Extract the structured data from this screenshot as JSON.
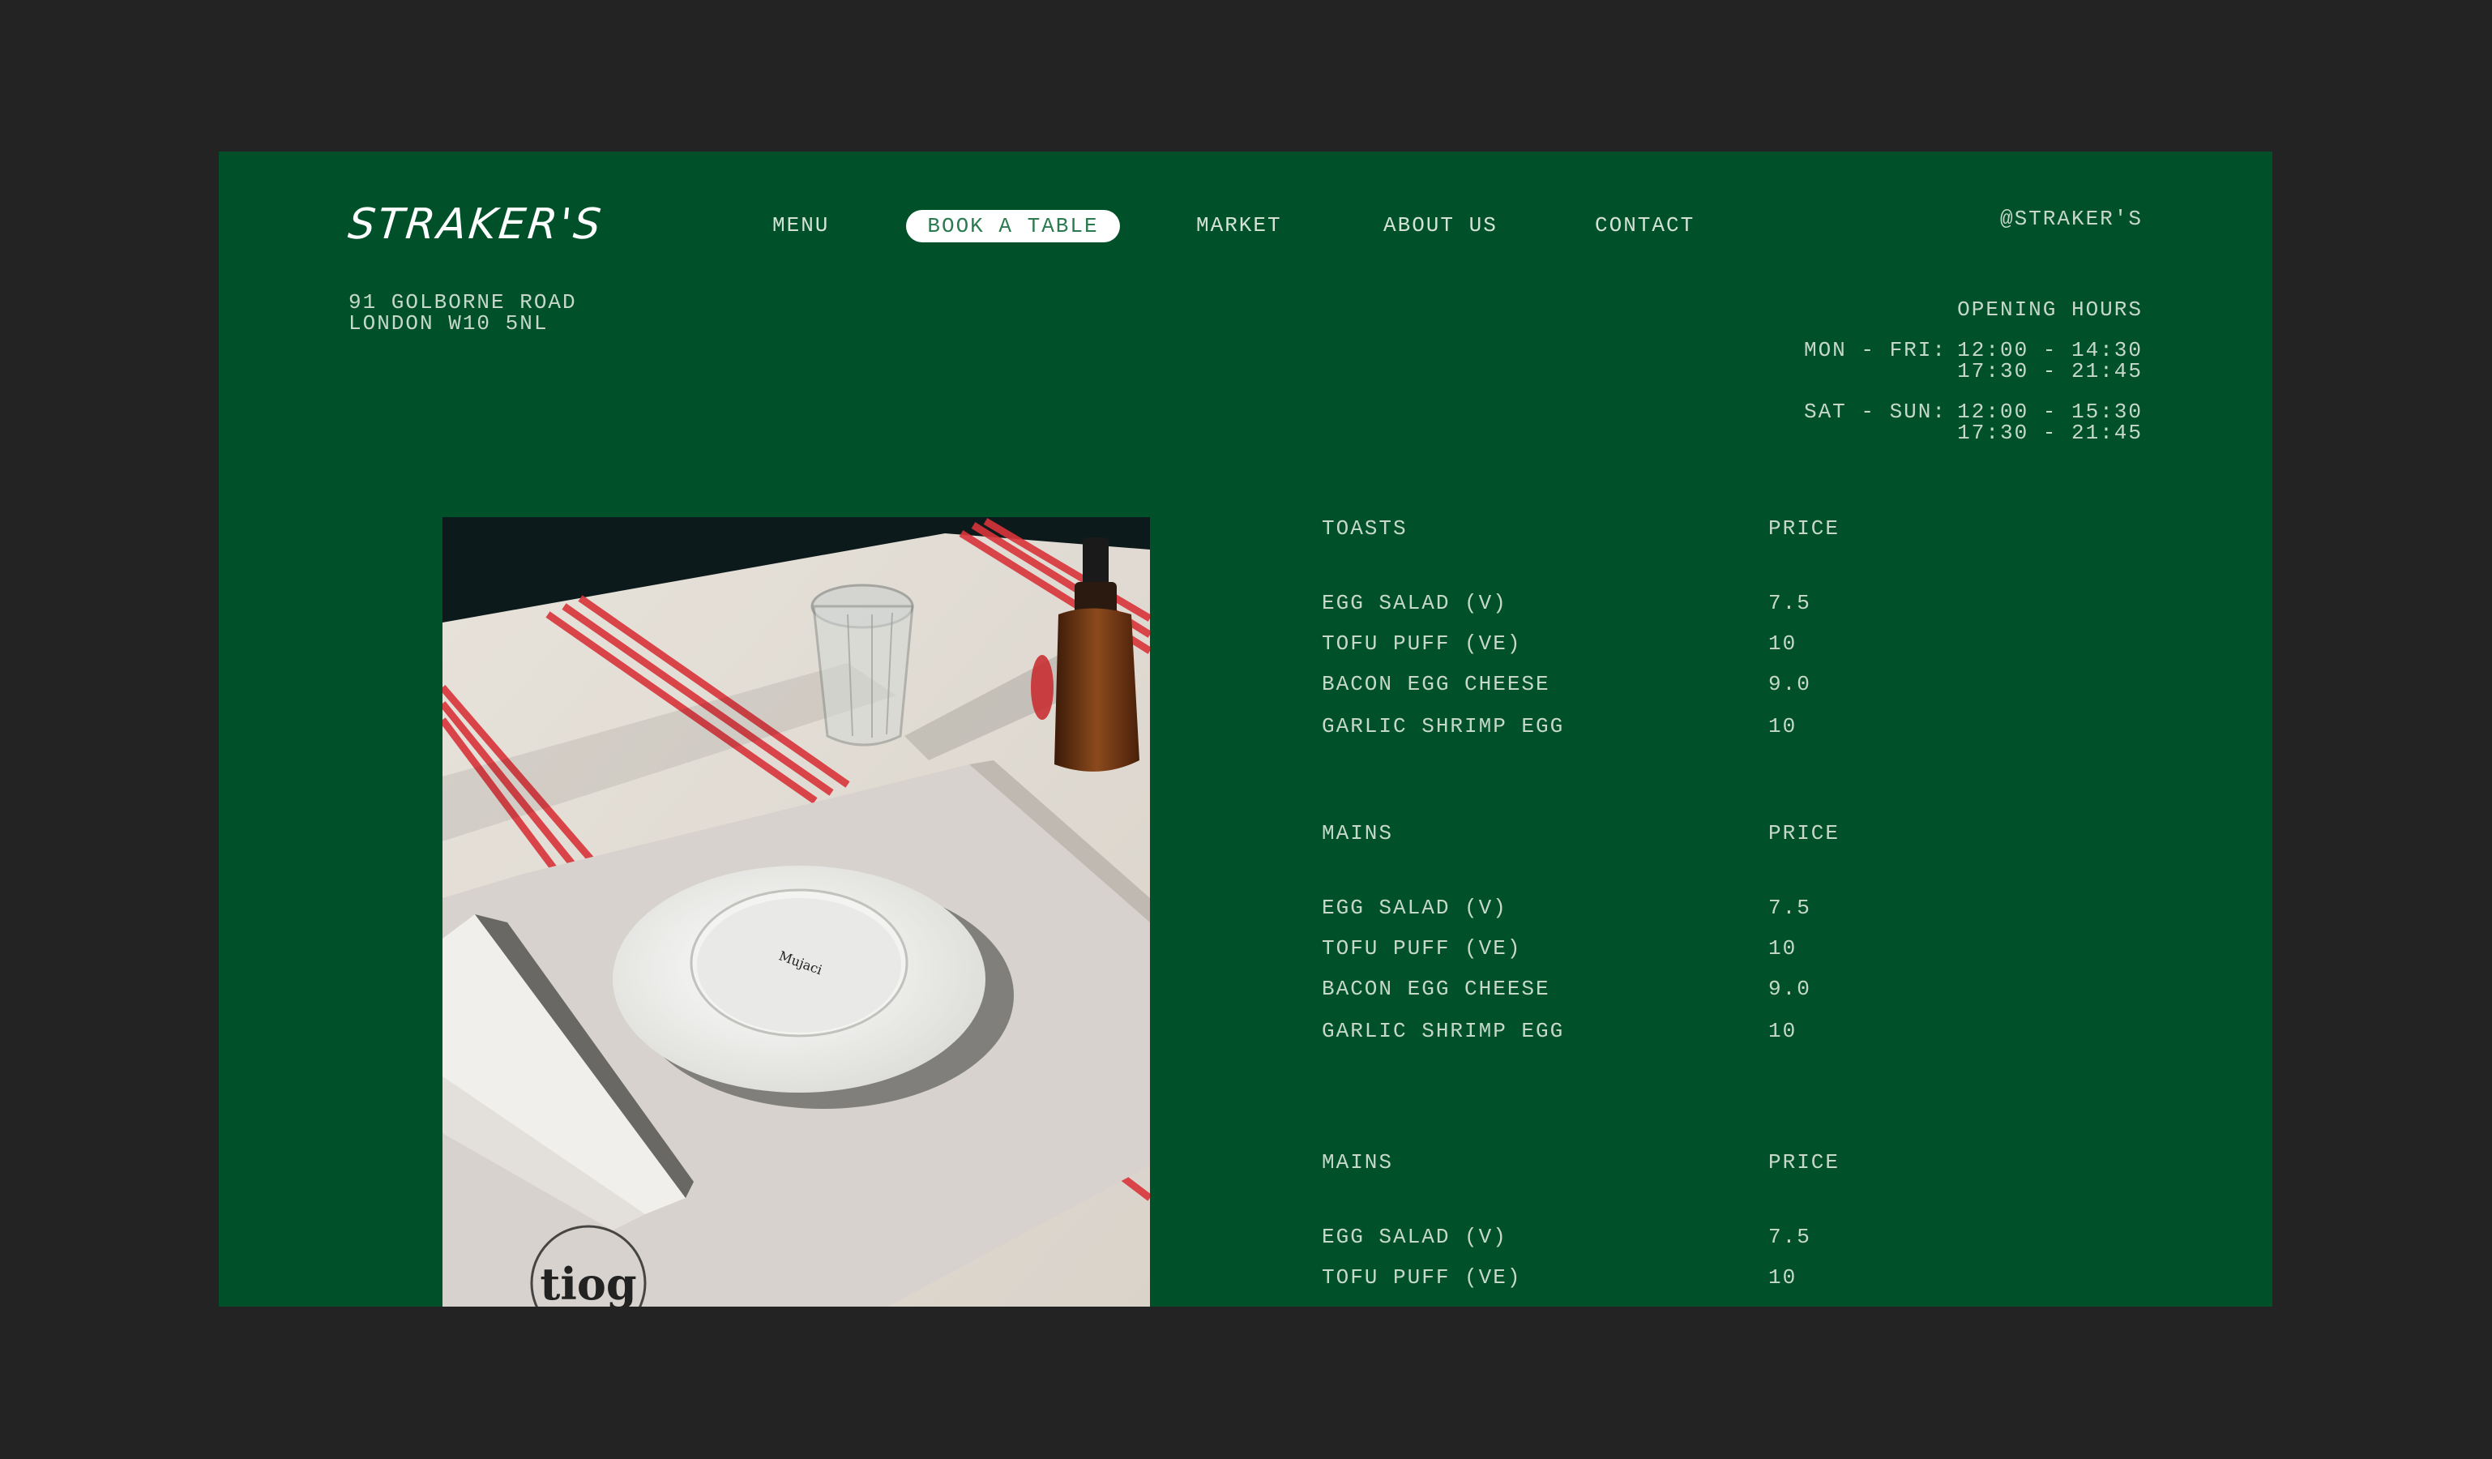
{
  "brand": {
    "logo_text": "STRAKER'S",
    "social_handle": "@STRAKER'S"
  },
  "nav": {
    "menu": "MENU",
    "book": "BOOK A TABLE",
    "market": "MARKET",
    "about": "ABOUT US",
    "contact": "CONTACT"
  },
  "address": {
    "line1": "91 GOLBORNE ROAD",
    "line2": "LONDON W10 5NL"
  },
  "hours": {
    "title": "OPENING HOURS",
    "weekday_label": "MON - FRI:",
    "weekday_slot1": "12:00 - 14:30",
    "weekday_slot2": "17:30 - 21:45",
    "weekend_label": "SAT - SUN:",
    "weekend_slot1": "12:00 - 15:30",
    "weekend_slot2": "17:30 - 21:45"
  },
  "menu": {
    "sections": [
      {
        "title": "TOASTS",
        "price_header": "PRICE",
        "items": [
          {
            "name": "EGG SALAD (V)",
            "price": "7.5"
          },
          {
            "name": "TOFU PUFF (VE)",
            "price": "10"
          },
          {
            "name": "BACON EGG CHEESE",
            "price": "9.0"
          },
          {
            "name": "GARLIC SHRIMP EGG",
            "price": "10"
          }
        ]
      },
      {
        "title": "MAINS",
        "price_header": "PRICE",
        "items": [
          {
            "name": "EGG SALAD (V)",
            "price": "7.5"
          },
          {
            "name": "TOFU PUFF (VE)",
            "price": "10"
          },
          {
            "name": "BACON EGG CHEESE",
            "price": "9.0"
          },
          {
            "name": "GARLIC SHRIMP EGG",
            "price": "10"
          }
        ]
      },
      {
        "title": "MAINS",
        "price_header": "PRICE",
        "items": [
          {
            "name": "EGG SALAD (V)",
            "price": "7.5"
          },
          {
            "name": "TOFU PUFF (VE)",
            "price": "10"
          }
        ]
      }
    ]
  },
  "photo": {
    "plate_stamp": "Mujaci",
    "placemat_mark": "tiog"
  },
  "colors": {
    "backdrop": "#232323",
    "panel_green": "#00512a",
    "text": "#c6d8c9",
    "button_bg": "#ffffff",
    "button_text": "#2a7a4f"
  }
}
